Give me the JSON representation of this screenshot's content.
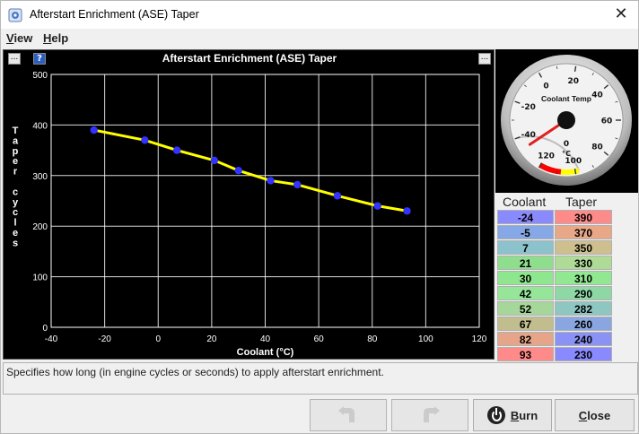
{
  "window": {
    "title": "Afterstart Enrichment (ASE) Taper"
  },
  "menu": {
    "view": "View",
    "view_key": "V",
    "view_rest": "iew",
    "help": "Help",
    "help_key": "H",
    "help_rest": "elp"
  },
  "chart_panel": {
    "more_left": "...",
    "help": "?",
    "more_right": "..."
  },
  "chart_data": {
    "type": "line",
    "title": "Afterstart Enrichment (ASE) Taper",
    "xlabel": "Coolant (°C)",
    "ylabel": "Taper cycles",
    "xlim": [
      -40,
      120
    ],
    "ylim": [
      0,
      500
    ],
    "x_ticks": [
      -40,
      -20,
      0,
      20,
      40,
      60,
      80,
      100,
      120
    ],
    "y_ticks": [
      0,
      100,
      200,
      300,
      400,
      500
    ],
    "grid": true,
    "series": [
      {
        "x": [
          -24,
          -5,
          7,
          21,
          30,
          42,
          52,
          67,
          82,
          93
        ],
        "y": [
          390,
          370,
          350,
          330,
          310,
          290,
          282,
          260,
          240,
          230
        ]
      }
    ],
    "colors": {
      "background": "#000000",
      "line": "#ffff00",
      "points": "#3333ff",
      "grid": "#ffffff",
      "text": "#ffffff"
    }
  },
  "gauge": {
    "title": "Coolant Temp",
    "value": "0",
    "unit": "°C",
    "min": -40,
    "max": 120,
    "current": 0,
    "ticks": [
      "-40",
      "-20",
      "0",
      "20",
      "40",
      "60",
      "80",
      "100",
      "120"
    ]
  },
  "table": {
    "headers": {
      "coolant": "Coolant",
      "taper": "Taper"
    },
    "coolant": [
      "-24",
      "-5",
      "7",
      "21",
      "30",
      "42",
      "52",
      "67",
      "82",
      "93"
    ],
    "taper": [
      "390",
      "370",
      "350",
      "330",
      "310",
      "290",
      "282",
      "260",
      "240",
      "230"
    ],
    "coolant_colors": [
      "#8a8aff",
      "#86a8e6",
      "#8bc2cc",
      "#8ede8e",
      "#8ee68e",
      "#96e69a",
      "#a6d79a",
      "#c2bd8e",
      "#e6a488",
      "#ff8a8a"
    ],
    "taper_colors": [
      "#ff8a8a",
      "#e8a888",
      "#cdc08e",
      "#aedc96",
      "#92e892",
      "#8ed8a6",
      "#8ec6c2",
      "#8aa6e0",
      "#8a92f6",
      "#8a8aff"
    ]
  },
  "status": {
    "text": "Specifies how long (in engine cycles or seconds) to apply afterstart enrichment."
  },
  "buttons": {
    "burn_key": "B",
    "burn_rest": "urn",
    "close_key": "C",
    "close_rest": "lose"
  }
}
